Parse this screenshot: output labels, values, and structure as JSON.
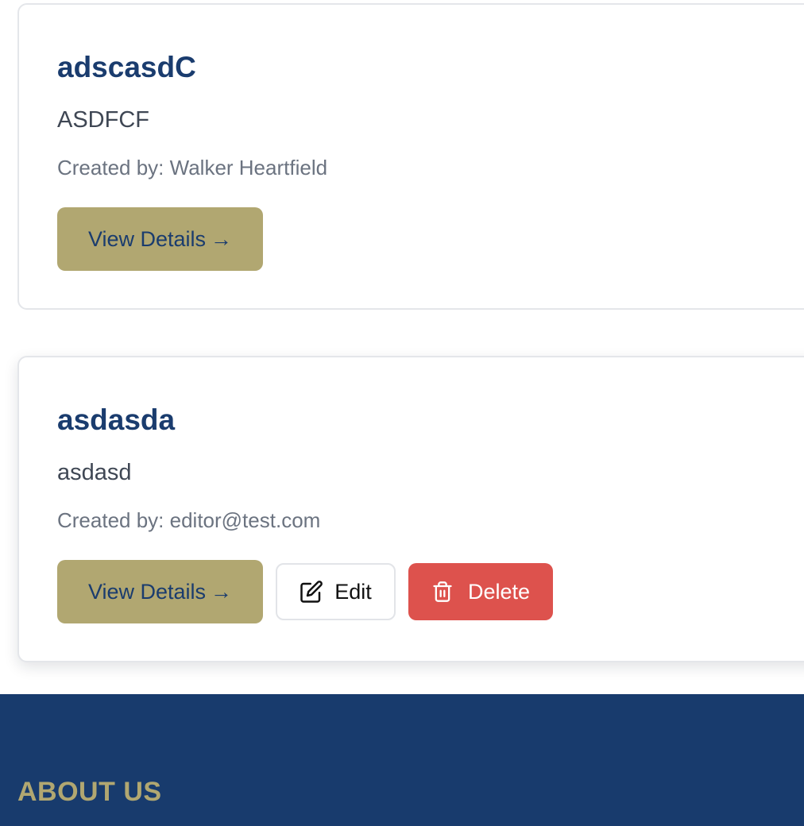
{
  "cards": [
    {
      "title": "adscasdC",
      "description": "ASDFCF",
      "created_by": "Created by: Walker Heartfield",
      "view_label": "View Details",
      "view_arrow": "→"
    },
    {
      "title": "asdasda",
      "description": "asdasd",
      "created_by": "Created by: editor@test.com",
      "view_label": "View Details",
      "view_arrow": "→",
      "edit_label": "Edit",
      "delete_label": "Delete"
    }
  ],
  "footer": {
    "heading": "ABOUT US"
  },
  "colors": {
    "primary_navy": "#1a3c6e",
    "accent_gold": "#b1a771",
    "danger_red": "#dd524d",
    "footer_bg": "#183b6d"
  },
  "icons": {
    "edit": "edit-icon",
    "delete": "trash-icon"
  }
}
